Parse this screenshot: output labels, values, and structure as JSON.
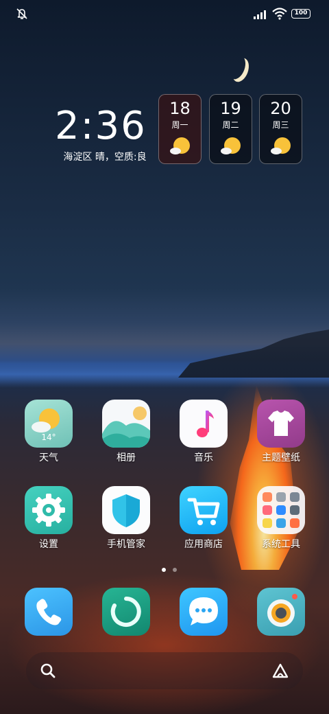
{
  "status_bar": {
    "left_icon": "mute-icon",
    "signal_icon": "signal-icon",
    "wifi_icon": "wifi-icon",
    "battery_text": "100"
  },
  "clock": {
    "time": "2:36",
    "weather_line": "海淀区 晴，空质:良"
  },
  "forecast": [
    {
      "date": "18",
      "weekday": "周一",
      "icon": "sunny-cloud-icon"
    },
    {
      "date": "19",
      "weekday": "周二",
      "icon": "sunny-cloud-icon"
    },
    {
      "date": "20",
      "weekday": "周三",
      "icon": "sunny-cloud-icon"
    }
  ],
  "apps": {
    "weather": {
      "label": "天气",
      "temp": "14°",
      "icon": "weather-icon"
    },
    "gallery": {
      "label": "相册",
      "icon": "gallery-icon"
    },
    "music": {
      "label": "音乐",
      "icon": "music-icon"
    },
    "themes": {
      "label": "主题壁纸",
      "icon": "shirt-icon"
    },
    "settings": {
      "label": "设置",
      "icon": "gear-icon"
    },
    "security": {
      "label": "手机管家",
      "icon": "shield-icon"
    },
    "store": {
      "label": "应用商店",
      "icon": "cart-icon"
    },
    "tools": {
      "label": "系统工具",
      "icon": "folder-icon"
    }
  },
  "dock": [
    {
      "name": "phone",
      "icon": "phone-icon"
    },
    {
      "name": "security-center",
      "icon": "ring-icon"
    },
    {
      "name": "messages",
      "icon": "chat-icon"
    },
    {
      "name": "camera",
      "icon": "camera-icon"
    }
  ],
  "pager": {
    "pages": 2,
    "current": 1
  },
  "search_bar": {
    "left_icon": "search-icon",
    "right_icon": "assistant-icon"
  },
  "colors": {
    "weather_tile": "#8fd3c6",
    "settings_tile": "#35c5b3",
    "themes_tile": "#a2459c",
    "store_tile": "#1fb6ff",
    "phone_tile": "#3db0f0",
    "messages_tile": "#2ea9f5",
    "ring_tile": "#1aa085",
    "camera_tile": "#4fb6c6",
    "sun": "#f8c23a"
  }
}
